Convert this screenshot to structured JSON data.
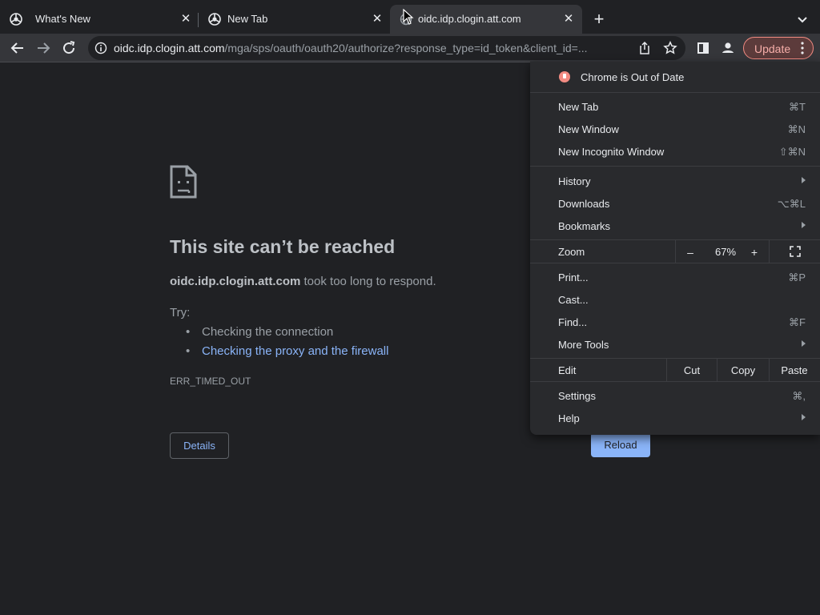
{
  "tabs": [
    {
      "title": "What's New",
      "close": "✕"
    },
    {
      "title": "New Tab",
      "close": "✕"
    },
    {
      "title": "oidc.idp.clogin.att.com",
      "close": "✕"
    }
  ],
  "new_tab_symbol": "+",
  "omnibox": {
    "host": "oidc.idp.clogin.att.com",
    "path": "/mga/sps/oauth/oauth20/authorize?response_type=id_token&client_id=..."
  },
  "update_label": "Update",
  "error": {
    "title": "This site can’t be reached",
    "host": "oidc.idp.clogin.att.com",
    "desc_rest": " took too long to respond.",
    "try_label": "Try:",
    "suggestions": [
      "Checking the connection",
      "Checking the proxy and the firewall"
    ],
    "code": "ERR_TIMED_OUT",
    "details_label": "Details",
    "reload_label": "Reload"
  },
  "menu": {
    "out_of_date": "Chrome is Out of Date",
    "new_tab": {
      "label": "New Tab",
      "shortcut": "⌘T"
    },
    "new_window": {
      "label": "New Window",
      "shortcut": "⌘N"
    },
    "new_incognito": {
      "label": "New Incognito Window",
      "shortcut": "⇧⌘N"
    },
    "history": {
      "label": "History"
    },
    "downloads": {
      "label": "Downloads",
      "shortcut": "⌥⌘L"
    },
    "bookmarks": {
      "label": "Bookmarks"
    },
    "zoom": {
      "label": "Zoom",
      "minus": "–",
      "value": "67%",
      "plus": "+"
    },
    "print": {
      "label": "Print...",
      "shortcut": "⌘P"
    },
    "cast": {
      "label": "Cast..."
    },
    "find": {
      "label": "Find...",
      "shortcut": "⌘F"
    },
    "more_tools": {
      "label": "More Tools"
    },
    "edit": {
      "label": "Edit",
      "cut": "Cut",
      "copy": "Copy",
      "paste": "Paste"
    },
    "settings": {
      "label": "Settings",
      "shortcut": "⌘,"
    },
    "help": {
      "label": "Help"
    }
  }
}
